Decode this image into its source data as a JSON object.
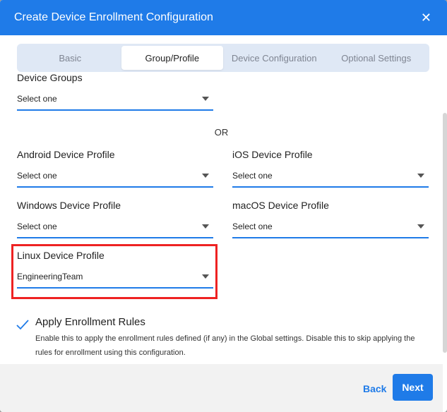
{
  "dialog": {
    "title": "Create Device Enrollment Configuration",
    "close_glyph": "✕"
  },
  "tabs": [
    {
      "label": "Basic",
      "active": false
    },
    {
      "label": "Group/Profile",
      "active": true
    },
    {
      "label": "Device Configuration",
      "active": false
    },
    {
      "label": "Optional Settings",
      "active": false
    }
  ],
  "fields": {
    "device_groups": {
      "label": "Device Groups",
      "value": "Select one"
    },
    "or_text": "OR",
    "android": {
      "label": "Android Device Profile",
      "value": "Select one"
    },
    "ios": {
      "label": "iOS Device Profile",
      "value": "Select one"
    },
    "windows": {
      "label": "Windows Device Profile",
      "value": "Select one"
    },
    "macos": {
      "label": "macOS Device Profile",
      "value": "Select one"
    },
    "linux": {
      "label": "Linux Device Profile",
      "value": "EngineeringTeam"
    }
  },
  "rules": {
    "checked": true,
    "title": "Apply Enrollment Rules",
    "description": "Enable this to apply the enrollment rules defined (if any) in the Global settings. Disable this to skip applying the rules for enrollment using this configuration."
  },
  "footer": {
    "back_label": "Back",
    "next_label": "Next"
  },
  "colors": {
    "accent": "#1f7be8",
    "highlight": "#ee2222"
  }
}
